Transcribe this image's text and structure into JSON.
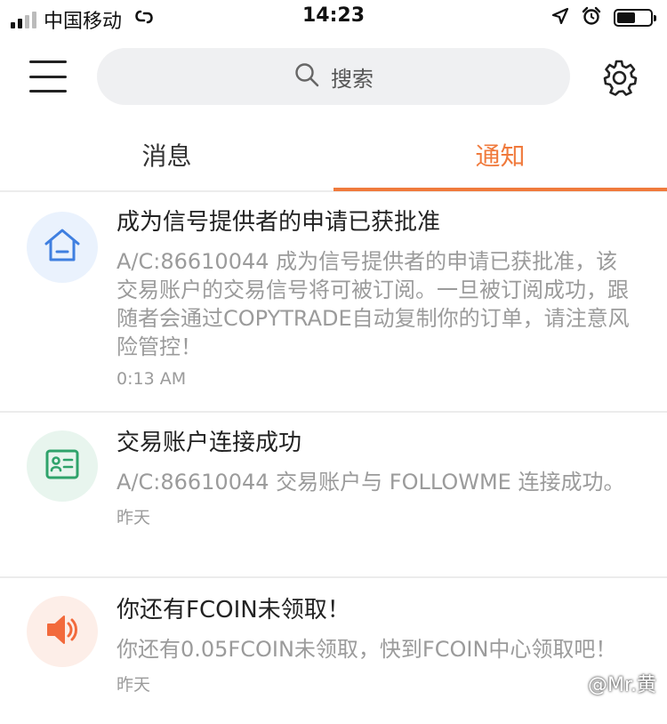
{
  "status_bar": {
    "carrier": "中国移动",
    "time": "14:23"
  },
  "header": {
    "search_placeholder": "搜索"
  },
  "tabs": [
    {
      "label": "消息",
      "active": false
    },
    {
      "label": "通知",
      "active": true
    }
  ],
  "colors": {
    "accent": "#f07a3c",
    "home_icon": "#3f7fe0",
    "card_icon": "#2fa36b",
    "speaker_icon": "#f26a3c"
  },
  "notifications": [
    {
      "icon": "home-icon",
      "title": "成为信号提供者的申请已获批准",
      "text": "A/C:86610044 成为信号提供者的申请已获批准，该交易账户的交易信号将可被订阅。一旦被订阅成功，跟随者会通过COPYTRADE自动复制你的订单，请注意风险管控！",
      "time": "0:13 AM"
    },
    {
      "icon": "id-card-icon",
      "title": "交易账户连接成功",
      "text": "A/C:86610044 交易账户与 FOLLOWME 连接成功。",
      "time": "昨天"
    },
    {
      "icon": "speaker-icon",
      "title": "你还有FCOIN未领取！",
      "text": "你还有0.05FCOIN未领取，快到FCOIN中心领取吧！",
      "time": "昨天"
    }
  ],
  "watermark": "@Mr.黄"
}
